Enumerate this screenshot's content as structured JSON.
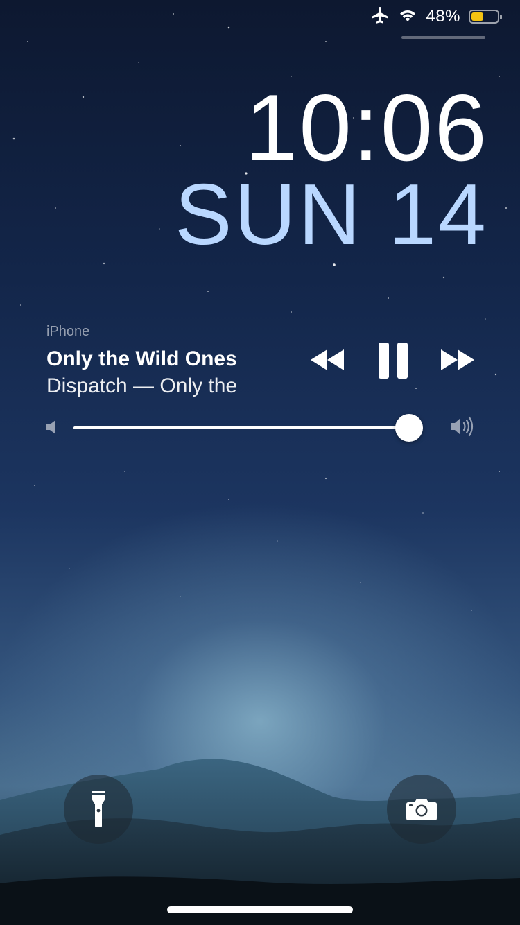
{
  "status_bar": {
    "airplane_icon": "airplane-icon",
    "wifi_icon": "wifi-icon",
    "battery_percent": "48%",
    "battery_level": 0.48,
    "battery_color": "#f4c312"
  },
  "clock": {
    "time": "10:06",
    "date": "SUN 14",
    "date_color": "#b9d7ff"
  },
  "now_playing": {
    "source": "iPhone",
    "title": "Only the Wild Ones",
    "subtitle": "Dispatch — Only the",
    "controls": {
      "rewind_icon": "rewind-icon",
      "pause_icon": "pause-icon",
      "forward_icon": "fast-forward-icon"
    },
    "volume_level": 0.96
  },
  "quick_actions": {
    "flashlight_icon": "flashlight-icon",
    "camera_icon": "camera-icon"
  }
}
